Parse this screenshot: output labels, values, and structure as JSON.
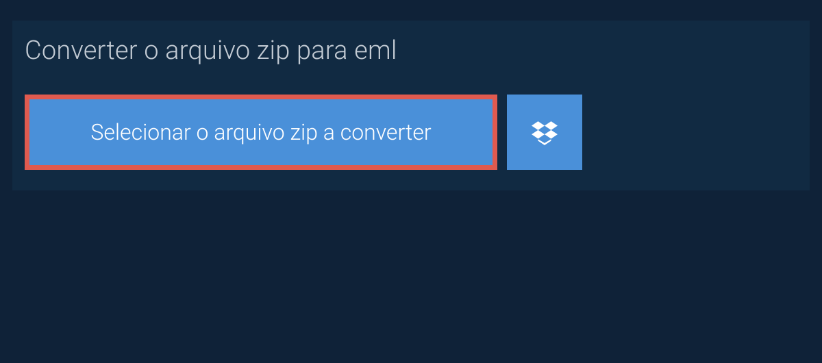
{
  "heading": "Converter o arquivo zip para eml",
  "select_button_label": "Selecionar o arquivo zip a converter",
  "colors": {
    "background": "#0f2238",
    "panel": "#112a42",
    "button": "#4a90d9",
    "highlight_border": "#e05a4f",
    "text_heading": "#c3cbd4",
    "text_button": "#ffffff"
  }
}
